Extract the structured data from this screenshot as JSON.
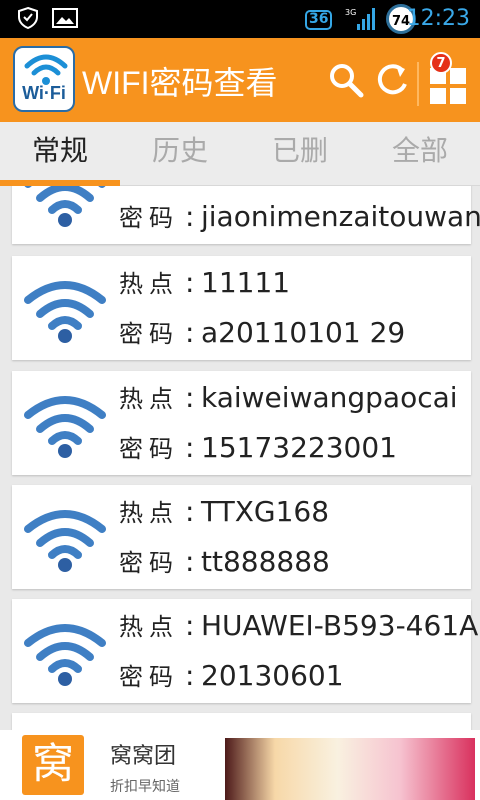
{
  "status_bar": {
    "network": "36",
    "signal_label": "3G",
    "battery": "74",
    "time": "12:23"
  },
  "app_bar": {
    "logo_text": "Wi·Fi",
    "title": "WIFI密码查看",
    "notification_count": "7",
    "accent": "#f7931e"
  },
  "tabs": [
    {
      "label": "常规",
      "active": true
    },
    {
      "label": "历史",
      "active": false
    },
    {
      "label": "已删",
      "active": false
    },
    {
      "label": "全部",
      "active": false
    }
  ],
  "labels": {
    "hotspot": "热点",
    "password": "密码",
    "colon": ":"
  },
  "entries": [
    {
      "ssid": "",
      "password": "jiaonimenzaitouwangluo"
    },
    {
      "ssid": "11111",
      "password": "a20110101 29"
    },
    {
      "ssid": "kaiweiwangpaocai",
      "password": "15173223001"
    },
    {
      "ssid": "TTXG168",
      "password": "tt888888"
    },
    {
      "ssid": "HUAWEI-B593-461A",
      "password": "20130601"
    }
  ],
  "ad": {
    "logo_text": "窝",
    "name": "窝窝团",
    "subtitle": "折扣早知道"
  }
}
